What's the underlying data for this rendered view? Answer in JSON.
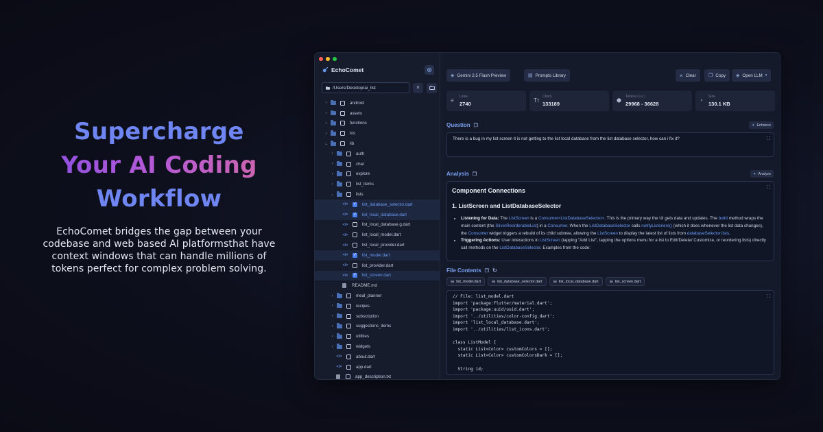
{
  "hero": {
    "title_line1": "Supercharge",
    "title_line2": "Your AI Coding",
    "title_line3": "Workflow",
    "description": "EchoComet bridges the gap between your codebase and web based AI platformsthat have context windows that can handle millions of tokens perfect for complex problem solving."
  },
  "colors": {
    "accent": "#4a80f0",
    "hero_blue": "#6f86f2",
    "hero_gradient_start": "#8a4fe0",
    "hero_gradient_end": "#d067a6",
    "traffic_red": "#ff5f57",
    "traffic_yellow": "#febc2e",
    "traffic_green": "#28c840"
  },
  "sidebar": {
    "app_name": "EchoComet",
    "path": "/Users/Desktop/ai_list",
    "tree": [
      {
        "label": "android",
        "type": "folder",
        "depth": 0,
        "expanded": false,
        "checked": false
      },
      {
        "label": "assets",
        "type": "folder",
        "depth": 0,
        "expanded": false,
        "checked": false
      },
      {
        "label": "functions",
        "type": "folder",
        "depth": 0,
        "expanded": false,
        "checked": false
      },
      {
        "label": "ios",
        "type": "folder",
        "depth": 0,
        "expanded": false,
        "checked": false
      },
      {
        "label": "lib",
        "type": "folder",
        "depth": 0,
        "expanded": true,
        "checked": false
      },
      {
        "label": "auth",
        "type": "folder",
        "depth": 1,
        "expanded": false,
        "checked": false
      },
      {
        "label": "chat",
        "type": "folder",
        "depth": 1,
        "expanded": false,
        "checked": false
      },
      {
        "label": "explore",
        "type": "folder",
        "depth": 1,
        "expanded": false,
        "checked": false
      },
      {
        "label": "list_items",
        "type": "folder",
        "depth": 1,
        "expanded": false,
        "checked": false
      },
      {
        "label": "lists",
        "type": "folder",
        "depth": 1,
        "expanded": true,
        "checked": false
      },
      {
        "label": "list_database_selector.dart",
        "type": "code",
        "depth": 2,
        "checked": true
      },
      {
        "label": "list_local_database.dart",
        "type": "code",
        "depth": 2,
        "checked": true
      },
      {
        "label": "list_local_database.g.dart",
        "type": "code",
        "depth": 2,
        "checked": false
      },
      {
        "label": "list_local_model.dart",
        "type": "code",
        "depth": 2,
        "checked": false
      },
      {
        "label": "list_local_provider.dart",
        "type": "code",
        "depth": 2,
        "checked": false
      },
      {
        "label": "list_model.dart",
        "type": "code",
        "depth": 2,
        "checked": true
      },
      {
        "label": "list_provider.dart",
        "type": "code",
        "depth": 2,
        "checked": false
      },
      {
        "label": "list_screen.dart",
        "type": "code",
        "depth": 2,
        "checked": true
      },
      {
        "label": "README.md",
        "type": "file",
        "depth": 2,
        "checked": false
      },
      {
        "label": "meal_planner",
        "type": "folder",
        "depth": 1,
        "expanded": false,
        "checked": false
      },
      {
        "label": "recipes",
        "type": "folder",
        "depth": 1,
        "expanded": false,
        "checked": false
      },
      {
        "label": "subscription",
        "type": "folder",
        "depth": 1,
        "expanded": false,
        "checked": false
      },
      {
        "label": "suggestions_items",
        "type": "folder",
        "depth": 1,
        "expanded": false,
        "checked": false
      },
      {
        "label": "utilities",
        "type": "folder",
        "depth": 1,
        "expanded": false,
        "checked": false
      },
      {
        "label": "widgets",
        "type": "folder",
        "depth": 1,
        "expanded": false,
        "checked": false
      },
      {
        "label": "about.dart",
        "type": "code",
        "depth": 1,
        "checked": false
      },
      {
        "label": "app.dart",
        "type": "code",
        "depth": 1,
        "checked": false
      },
      {
        "label": "app_description.txt",
        "type": "text",
        "depth": 1,
        "checked": false
      }
    ]
  },
  "toolbar": {
    "model_label": "Gemini 2.5 Flash Preview",
    "prompts_label": "Prompts Library",
    "clear_label": "Clear",
    "copy_label": "Copy",
    "open_llm_label": "Open LLM"
  },
  "stats": {
    "lines_label": "Lines",
    "lines_value": "2740",
    "chars_label": "Chars",
    "chars_value": "133189",
    "tokens_label": "Tokens",
    "tokens_sub": "(est.)",
    "tokens_value": "29968 - 36628",
    "size_label": "Size",
    "size_value": "130.1 KB"
  },
  "question": {
    "title": "Question",
    "enhance_label": "Enhance",
    "text": "There is a bug in my list screen it is not getting to the list local database from the list database selector, how can i fix it?"
  },
  "analysis": {
    "title": "Analysis",
    "analyze_label": "Analyze",
    "heading": "Component Connections",
    "subheading": "1. ListScreen and ListDatabaseSelector",
    "b1_title": "Listening for Data:",
    "b1_t1": " The ",
    "b1_c1": "ListScreen",
    "b1_t2": " is a ",
    "b1_c2": "Consumer<ListDatabaseSelector>",
    "b1_t3": ". This is the primary way the UI gets data and updates. The ",
    "b1_c3": "build",
    "b1_t4": " method wraps the main content (the ",
    "b1_c4": "SliverReorderableList",
    "b1_t5": ") in a ",
    "b1_c5": "Consumer",
    "b1_t6": ". When the ",
    "b1_c6": "ListDatabaseSelector",
    "b1_t7": " calls ",
    "b1_c7": "notifyListeners()",
    "b1_t8": " (which it does whenever the list data changes), the ",
    "b1_c8": "Consumer",
    "b1_t9": " widget triggers a rebuild of its child subtree, allowing the ",
    "b1_c9": "ListScreen",
    "b1_t10": " to display the latest list of lists from ",
    "b1_c10": "databaseSelector.lists",
    "b1_t11": ".",
    "b2_title": "Triggering Actions:",
    "b2_t1": " User interactions in ",
    "b2_c1": "ListScreen",
    "b2_t2": " (tapping \"Add List\", tapping the options menu for a list to Edit/Delete/ Customize, or reordering lists) directly call methods on the ",
    "b2_c2": "ListDatabaseSelector",
    "b2_t3": ". Examples from the code:"
  },
  "file_contents": {
    "title": "File Contents",
    "tabs": [
      "list_model.dart",
      "list_database_selector.dart",
      "list_local_database.dart",
      "list_screen.dart"
    ],
    "code_lines": [
      "// File: list_model.dart",
      "import 'package:flutter/material.dart';",
      "import 'package:uuid/uuid.dart';",
      "import '../utilities/color-config.dart';",
      "import 'list_local_database.dart';",
      "import '../utilities/list_icons.dart';",
      "",
      "class ListModel {",
      "  static List<Color> customColors = [];",
      "  static List<Color> customColorsDark = [];",
      "",
      "  String id;"
    ]
  }
}
